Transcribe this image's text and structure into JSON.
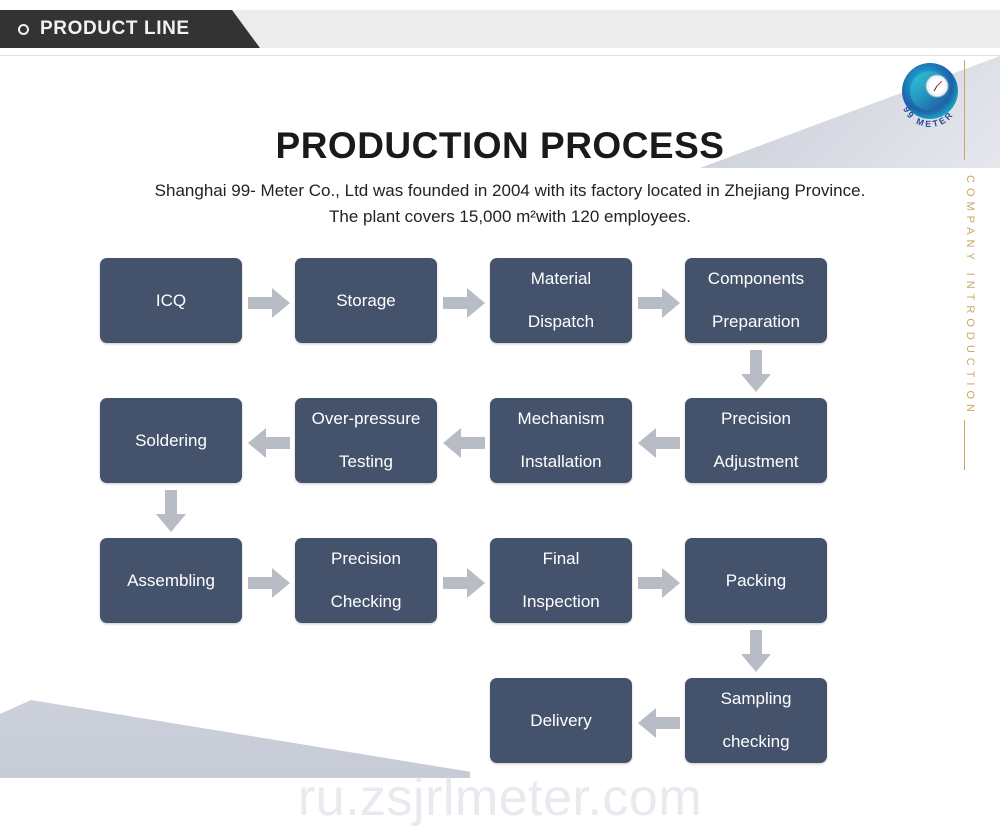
{
  "header": {
    "tag_label": "PRODUCT LINE",
    "bullet_icon": "circle-outline-icon"
  },
  "brand": {
    "logo_text": "99 METER",
    "logo_icon": "spiral-gauge-logo-icon",
    "vertical_label": "COMPANY INTRODUCTION",
    "accent_gold": "#c9a961",
    "accent_teal": "#1aa6c4"
  },
  "title": "PRODUCTION PROCESS",
  "subtitle": "Shanghai 99- Meter Co., Ltd was founded in 2004 with its factory located in Zhejiang Province. The plant covers 15,000 m²with 120 employees.",
  "colors": {
    "node_fill": "#44536b",
    "node_text": "#ffffff",
    "arrow_fill": "#b8bcc4",
    "header_band": "#ececec",
    "header_tag": "#333333",
    "decor_shape": "#ccd0da"
  },
  "flow": {
    "nodes": [
      {
        "id": "icq",
        "label": "ICQ"
      },
      {
        "id": "storage",
        "label": "Storage"
      },
      {
        "id": "material-dispatch",
        "label": "Material\nDispatch",
        "line1": "Material",
        "line2": "Dispatch"
      },
      {
        "id": "components-preparation",
        "label": "Components\nPreparation",
        "line1": "Components",
        "line2": "Preparation"
      },
      {
        "id": "precision-adjustment",
        "label": "Precision\nAdjustment",
        "line1": "Precision",
        "line2": "Adjustment"
      },
      {
        "id": "mechanism-installation",
        "label": "Mechanism\nInstallation",
        "line1": "Mechanism",
        "line2": "Installation"
      },
      {
        "id": "over-pressure-testing",
        "label": "Over-pressure\nTesting",
        "line1": "Over-pressure",
        "line2": "Testing"
      },
      {
        "id": "soldering",
        "label": "Soldering"
      },
      {
        "id": "assembling",
        "label": "Assembling"
      },
      {
        "id": "precision-checking",
        "label": "Precision\nChecking",
        "line1": "Precision",
        "line2": "Checking"
      },
      {
        "id": "final-inspection",
        "label": "Final\nInspection",
        "line1": "Final",
        "line2": "Inspection"
      },
      {
        "id": "packing",
        "label": "Packing"
      },
      {
        "id": "sampling-checking",
        "label": "Sampling\nchecking",
        "line1": "Sampling",
        "line2": "checking"
      },
      {
        "id": "delivery",
        "label": "Delivery"
      }
    ],
    "arrows": [
      {
        "id": "icq-to-storage",
        "direction": "right"
      },
      {
        "id": "storage-to-material-dispatch",
        "direction": "right"
      },
      {
        "id": "material-dispatch-to-components-preparation",
        "direction": "right"
      },
      {
        "id": "components-preparation-to-precision-adjustment",
        "direction": "down"
      },
      {
        "id": "precision-adjustment-to-mechanism-installation",
        "direction": "left"
      },
      {
        "id": "mechanism-installation-to-over-pressure-testing",
        "direction": "left"
      },
      {
        "id": "over-pressure-testing-to-soldering",
        "direction": "left"
      },
      {
        "id": "soldering-to-assembling",
        "direction": "down"
      },
      {
        "id": "assembling-to-precision-checking",
        "direction": "right"
      },
      {
        "id": "precision-checking-to-final-inspection",
        "direction": "right"
      },
      {
        "id": "final-inspection-to-packing",
        "direction": "right"
      },
      {
        "id": "packing-to-sampling-checking",
        "direction": "down"
      },
      {
        "id": "sampling-checking-to-delivery",
        "direction": "left"
      }
    ]
  },
  "watermark": "ru.zsjrlmeter.com"
}
